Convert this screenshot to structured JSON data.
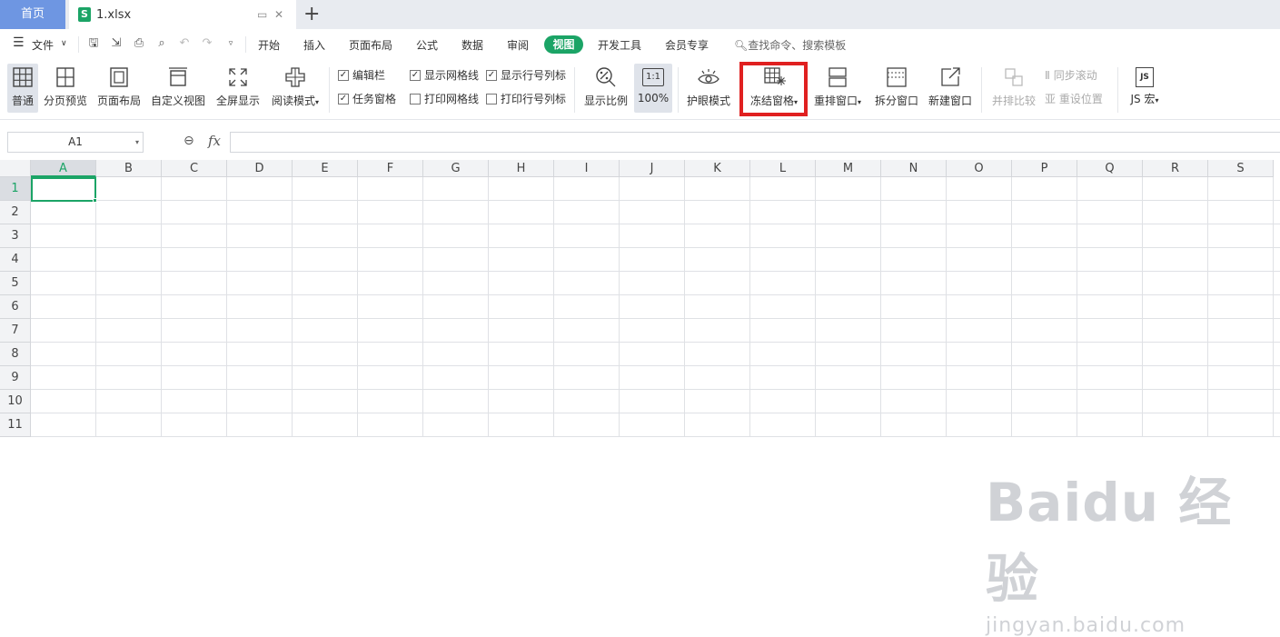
{
  "tabs": {
    "home": "首页",
    "file": "1.xlsx",
    "file_icon": "S"
  },
  "menu": {
    "file": "文件",
    "tabs": [
      "开始",
      "插入",
      "页面布局",
      "公式",
      "数据",
      "审阅",
      "视图",
      "开发工具",
      "会员专享"
    ],
    "active_tab": "视图",
    "search": "查找命令、搜索模板"
  },
  "ribbon": {
    "normal": "普通",
    "page_break_preview": "分页预览",
    "page_layout": "页面布局",
    "custom_view": "自定义视图",
    "full_screen": "全屏显示",
    "reading_mode": "阅读模式",
    "checkboxes": {
      "edit_bar": "编辑栏",
      "task_pane": "任务窗格",
      "show_gridlines": "显示网格线",
      "print_gridlines": "打印网格线",
      "show_headings": "显示行号列标",
      "print_headings": "打印行号列标"
    },
    "zoom_ratio": "显示比例",
    "zoom_100": "100%",
    "zoom_100_icon": "1:1",
    "eye_protection": "护眼模式",
    "freeze_panes": "冻结窗格",
    "arrange_windows": "重排窗口",
    "split_window": "拆分窗口",
    "new_window": "新建窗口",
    "side_by_side": "并排比较",
    "sync_scroll": "同步滚动",
    "reset_position": "重设位置",
    "js_macro": "JS 宏",
    "js_icon": "JS"
  },
  "formula_bar": {
    "name_box": "A1",
    "fx": "fx"
  },
  "grid": {
    "columns": [
      "A",
      "B",
      "C",
      "D",
      "E",
      "F",
      "G",
      "H",
      "I",
      "J",
      "K",
      "L",
      "M",
      "N",
      "O",
      "P",
      "Q",
      "R",
      "S"
    ],
    "rows": [
      "1",
      "2",
      "3",
      "4",
      "5",
      "6",
      "7",
      "8",
      "9",
      "10",
      "11"
    ],
    "selected_cell": "A1"
  },
  "watermark": {
    "logo": "Baidu 经验",
    "url": "jingyan.baidu.com"
  },
  "colors": {
    "accent": "#1ba466",
    "home_tab": "#6e96e2",
    "highlight": "#e02020"
  }
}
